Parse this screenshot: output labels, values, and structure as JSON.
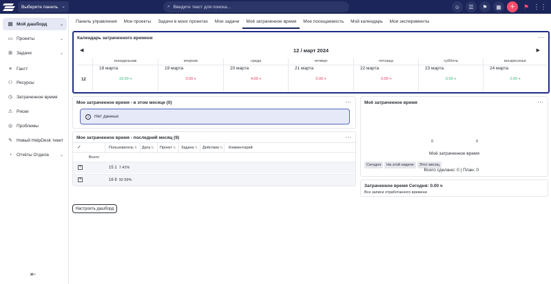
{
  "topbar": {
    "panel_select": "Выберите панель",
    "search_placeholder": "Введите текст для поиска..."
  },
  "sidebar": {
    "items": [
      {
        "label": "Мой дашборд"
      },
      {
        "label": "Проекты"
      },
      {
        "label": "Задачи"
      },
      {
        "label": "Гантт"
      },
      {
        "label": "Ресурсы"
      },
      {
        "label": "Затраченное время"
      },
      {
        "label": "Риски"
      },
      {
        "label": "Проблемы"
      },
      {
        "label": "Новый HelpDesk тикет"
      },
      {
        "label": "Отчёты Отдела"
      }
    ]
  },
  "tabs": [
    {
      "label": "Панель управления"
    },
    {
      "label": "Мои проекты"
    },
    {
      "label": "Задачи в моих проектах"
    },
    {
      "label": "Мои задачи"
    },
    {
      "label": "Моё затраченное время"
    },
    {
      "label": "Мое посещаемость"
    },
    {
      "label": "Мой календарь"
    },
    {
      "label": "Мои эксперименты"
    }
  ],
  "calendar": {
    "title": "Календарь затраченного времени",
    "date_label": "12 / март 2024",
    "week_number": "12",
    "days": [
      {
        "dow": "понедельник",
        "date": "18 марта",
        "value": "16.00 ч",
        "status": "green"
      },
      {
        "dow": "вторник",
        "date": "19 марта",
        "value": "0.00 ч",
        "status": "red"
      },
      {
        "dow": "среда",
        "date": "20 марта",
        "value": "4.00 ч",
        "status": "red"
      },
      {
        "dow": "четверг",
        "date": "21 марта",
        "value": "0.00 ч",
        "status": "red"
      },
      {
        "dow": "пятница",
        "date": "22 марта",
        "value": "0.00 ч",
        "status": "red"
      },
      {
        "dow": "суббота",
        "date": "23 марта",
        "value": "0.00 ч",
        "status": "green"
      },
      {
        "dow": "воскресенье",
        "date": "24 марта",
        "value": "0.00 ч",
        "status": "green"
      }
    ]
  },
  "month_widget": {
    "title": "Мое затраченное время - в этом месяце (0)",
    "info": "Нет данных"
  },
  "last_month_widget": {
    "title": "Мое затраченное время - последний месяц (9)",
    "columns": [
      "Пользователь",
      "Дата",
      "Проект",
      "Задача",
      "Действие",
      "Комментарий"
    ],
    "total_label": "Всего:",
    "rows": [
      {
        "value": "15 1",
        "pct": "7.41%"
      },
      {
        "value": "16 8",
        "pct": "92.59%"
      }
    ]
  },
  "setup_button": "Настроить дашборд",
  "my_time_widget": {
    "title": "Моё затраченное время",
    "zero_left": "0",
    "zero_right": "0",
    "chart_title": "Моё затраченное время",
    "buttons": [
      "Сегодня",
      "На этой неделе",
      "Этот месяц"
    ],
    "total": "Всего сделано: 0 | План: 0"
  },
  "today_widget": {
    "title": "Затраченное время Сегодня: 0.00 ч",
    "subtitle": "Все записи отработанного времени"
  },
  "colors": {
    "topbar": "#1b2559",
    "accent": "#ff4d6d",
    "green": "#2eb872",
    "red": "#e2355b",
    "calendar_border": "#1f2a8a"
  }
}
